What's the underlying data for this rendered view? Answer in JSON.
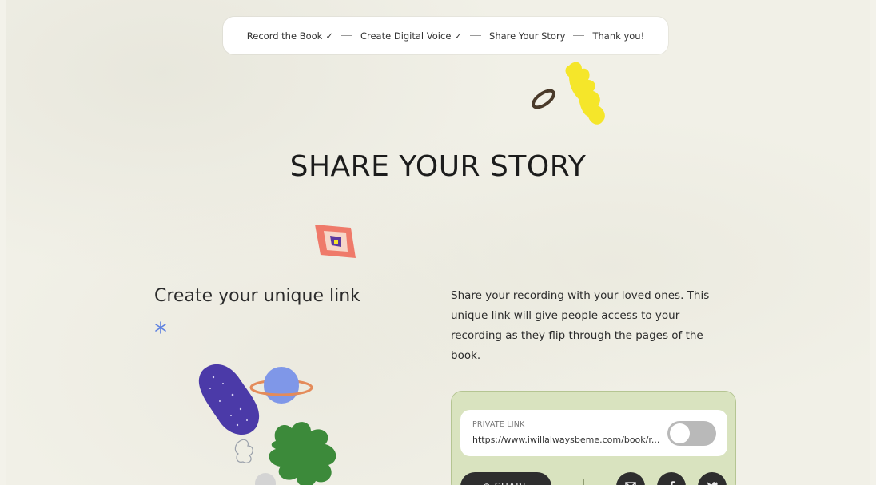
{
  "stepper": {
    "steps": [
      {
        "label": "Record the Book",
        "check": "✓"
      },
      {
        "label": "Create Digital Voice",
        "check": "✓"
      },
      {
        "label": "Share Your Story",
        "check": ""
      },
      {
        "label": "Thank you!",
        "check": ""
      }
    ]
  },
  "title": "SHARE YOUR STORY",
  "subtitle": "Create your unique link",
  "description": "Share your recording with your loved ones. This unique link will give people access to your recording as they flip through the pages of the book.",
  "share_panel": {
    "private_label": "PRIVATE LINK",
    "url": "https://www.iwillalwaysbeme.com/book/r...",
    "toggle_on": false,
    "share_button": "⊕ SHARE",
    "icons": [
      "email-icon",
      "facebook-icon",
      "twitter-icon"
    ]
  },
  "colors": {
    "background": "#f1f0e7",
    "panel": "#d9e3bf",
    "dark_button": "#2e2e2e",
    "accent_yellow": "#f5e62a",
    "accent_purple": "#4b3aa8",
    "accent_green": "#3c8a3a",
    "accent_orange": "#e48b5a",
    "accent_blue": "#5b7fe0"
  }
}
